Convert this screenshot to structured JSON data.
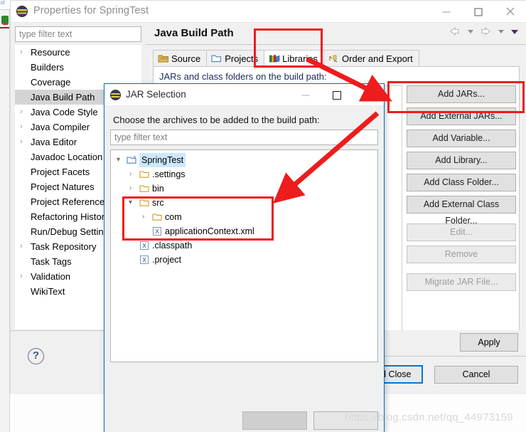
{
  "properties_window": {
    "title": "Properties for SpringTest",
    "title_icon": "eclipse-icon",
    "window_controls": {
      "minimize": "—",
      "maximize": "□",
      "close": "×"
    },
    "filter": {
      "placeholder": "type filter text",
      "value": ""
    },
    "tree_items": [
      {
        "label": "Resource",
        "expandable": true,
        "selected": false
      },
      {
        "label": "Builders",
        "expandable": false,
        "selected": false
      },
      {
        "label": "Coverage",
        "expandable": false,
        "selected": false
      },
      {
        "label": "Java Build Path",
        "expandable": false,
        "selected": true
      },
      {
        "label": "Java Code Style",
        "expandable": true,
        "selected": false
      },
      {
        "label": "Java Compiler",
        "expandable": true,
        "selected": false
      },
      {
        "label": "Java Editor",
        "expandable": true,
        "selected": false
      },
      {
        "label": "Javadoc Location",
        "expandable": false,
        "selected": false
      },
      {
        "label": "Project Facets",
        "expandable": false,
        "selected": false
      },
      {
        "label": "Project Natures",
        "expandable": false,
        "selected": false
      },
      {
        "label": "Project References",
        "expandable": false,
        "selected": false
      },
      {
        "label": "Refactoring History",
        "expandable": false,
        "selected": false
      },
      {
        "label": "Run/Debug Settings",
        "expandable": false,
        "selected": false
      },
      {
        "label": "Task Repository",
        "expandable": true,
        "selected": false
      },
      {
        "label": "Task Tags",
        "expandable": false,
        "selected": false
      },
      {
        "label": "Validation",
        "expandable": true,
        "selected": false
      },
      {
        "label": "WikiText",
        "expandable": false,
        "selected": false
      }
    ],
    "page_title": "Java Build Path",
    "nav": {
      "back": "back-arrow-icon",
      "back_menu": "chevron-down-icon",
      "forward": "forward-arrow-icon",
      "forward_menu": "chevron-down-icon",
      "view_menu": "view-menu-icon"
    },
    "tabs": [
      {
        "label": "Source",
        "icon": "source-folder-icon",
        "active": false
      },
      {
        "label": "Projects",
        "icon": "projects-folder-icon",
        "active": false
      },
      {
        "label": "Libraries",
        "icon": "libraries-books-icon",
        "active": true
      },
      {
        "label": "Order and Export",
        "icon": "order-export-icon",
        "active": false
      }
    ],
    "content_label": "JARs and class folders on the build path:",
    "buttons": [
      {
        "label": "Add JARs...",
        "enabled": true
      },
      {
        "label": "Add External JARs...",
        "enabled": true
      },
      {
        "label": "Add Variable...",
        "enabled": true
      },
      {
        "label": "Add Library...",
        "enabled": true
      },
      {
        "label": "Add Class Folder...",
        "enabled": true
      },
      {
        "label": "Add External Class Folder...",
        "enabled": true
      },
      {
        "label": "Edit...",
        "enabled": false
      },
      {
        "label": "Remove",
        "enabled": false
      },
      {
        "label": "Migrate JAR File...",
        "enabled": false
      }
    ],
    "help_icon": "help-question-icon",
    "footer": {
      "apply": "Apply",
      "apply_and_close": "Apply and Close",
      "cancel": "Cancel"
    }
  },
  "jar_dialog": {
    "title": "JAR Selection",
    "title_icon": "eclipse-icon",
    "window_controls": {
      "minimize": "—",
      "maximize": "□",
      "close": "×"
    },
    "prompt": "Choose the archives to be added to the build path:",
    "filter": {
      "placeholder": "type filter text",
      "value": ""
    },
    "tree": [
      {
        "label": "SpringTest",
        "depth": 0,
        "twisty": "⌄",
        "icon": "project-folder-icon",
        "selected": true
      },
      {
        "label": ".settings",
        "depth": 1,
        "twisty": "›",
        "icon": "folder-icon",
        "selected": false
      },
      {
        "label": "bin",
        "depth": 1,
        "twisty": "›",
        "icon": "folder-icon",
        "selected": false
      },
      {
        "label": "src",
        "depth": 1,
        "twisty": "⌄",
        "icon": "folder-icon",
        "selected": false
      },
      {
        "label": "com",
        "depth": 2,
        "twisty": "›",
        "icon": "folder-icon",
        "selected": false
      },
      {
        "label": "applicationContext.xml",
        "depth": 2,
        "twisty": "",
        "icon": "xml-file-icon",
        "selected": false
      },
      {
        "label": ".classpath",
        "depth": 1,
        "twisty": "",
        "icon": "xml-file-icon",
        "selected": false
      },
      {
        "label": ".project",
        "depth": 1,
        "twisty": "",
        "icon": "xml-file-icon",
        "selected": false
      }
    ],
    "buttons": {
      "ok": "",
      "cancel": ""
    }
  },
  "annotations": {
    "accent_color": "#ee1c1c",
    "boxes": [
      {
        "name": "libraries-tab-highlight"
      },
      {
        "name": "add-jars-highlight"
      },
      {
        "name": "src-folder-highlight"
      }
    ],
    "arrows": [
      {
        "name": "arrow-to-add-jars"
      },
      {
        "name": "arrow-to-src"
      }
    ]
  },
  "watermark": {
    "text": "https://blog.csdn.net/qq_44973159"
  }
}
